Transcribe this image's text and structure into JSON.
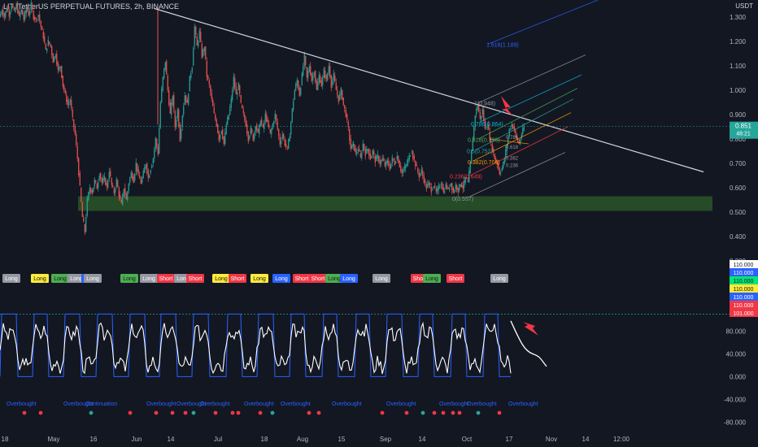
{
  "header": {
    "title": "LIT /TetherUS PERPETUAL FUTURES, 2h, BINANCE",
    "currency": "USDT"
  },
  "colors": {
    "background": "#131722",
    "up": "#26a69a",
    "down": "#ef5350",
    "trendline": "#d1d4dc",
    "demand_zone": "#2e5e2a",
    "axis_text": "#b2b5be",
    "current_price_bg": "#26a69a"
  },
  "chart_data": [
    {
      "type": "candlestick",
      "title": "LIT /TetherUS PERPETUAL FUTURES, 2h, BINANCE",
      "y_axis_ticks": [
        "1.300",
        "1.200",
        "1.100",
        "1.000",
        "0.900",
        "0.800",
        "0.700",
        "0.600",
        "0.500",
        "0.400",
        "0.300"
      ],
      "ylim": [
        0.27,
        1.37
      ],
      "x_axis_ticks": [
        "18",
        "May",
        "16",
        "Jun",
        "14",
        "Jul",
        "18",
        "Aug",
        "15",
        "Sep",
        "14",
        "Oct",
        "17",
        "Nov",
        "14",
        "12:00"
      ],
      "current_price": "0.851",
      "countdown": "48:21",
      "price_path": [
        [
          0,
          1.3
        ],
        [
          3,
          1.33
        ],
        [
          6,
          1.3
        ],
        [
          9,
          1.34
        ],
        [
          12,
          1.31
        ],
        [
          15,
          1.35
        ],
        [
          18,
          1.32
        ],
        [
          21,
          1.35
        ],
        [
          24,
          1.3
        ],
        [
          27,
          1.33
        ],
        [
          30,
          1.29
        ],
        [
          33,
          1.34
        ],
        [
          36,
          1.31
        ],
        [
          39,
          1.35
        ],
        [
          42,
          1.3
        ],
        [
          45,
          1.29
        ],
        [
          48,
          1.31
        ],
        [
          51,
          1.26
        ],
        [
          54,
          1.22
        ],
        [
          57,
          1.16
        ],
        [
          60,
          1.2
        ],
        [
          63,
          1.18
        ],
        [
          66,
          1.12
        ],
        [
          69,
          1.15
        ],
        [
          72,
          1.08
        ],
        [
          75,
          1.1
        ],
        [
          78,
          1.02
        ],
        [
          81,
          0.98
        ],
        [
          84,
          0.94
        ],
        [
          87,
          0.96
        ],
        [
          90,
          0.88
        ],
        [
          93,
          0.82
        ],
        [
          96,
          0.72
        ],
        [
          99,
          0.6
        ],
        [
          102,
          0.48
        ],
        [
          105,
          0.42
        ],
        [
          108,
          0.55
        ],
        [
          111,
          0.6
        ],
        [
          114,
          0.58
        ],
        [
          117,
          0.63
        ],
        [
          120,
          0.6
        ],
        [
          123,
          0.66
        ],
        [
          126,
          0.62
        ],
        [
          129,
          0.64
        ],
        [
          132,
          0.6
        ],
        [
          135,
          0.67
        ],
        [
          138,
          0.61
        ],
        [
          141,
          0.58
        ],
        [
          144,
          0.63
        ],
        [
          147,
          0.57
        ],
        [
          150,
          0.53
        ],
        [
          153,
          0.6
        ],
        [
          156,
          0.55
        ],
        [
          159,
          0.62
        ],
        [
          162,
          0.66
        ],
        [
          165,
          0.63
        ],
        [
          168,
          0.7
        ],
        [
          171,
          0.65
        ],
        [
          174,
          0.62
        ],
        [
          177,
          0.66
        ],
        [
          180,
          0.7
        ],
        [
          183,
          0.64
        ],
        [
          186,
          0.68
        ],
        [
          189,
          0.72
        ],
        [
          192,
          0.8
        ],
        [
          195,
          0.74
        ],
        [
          198,
          0.95
        ],
        [
          201,
          1.05
        ],
        [
          204,
          1.12
        ],
        [
          207,
          1.0
        ],
        [
          210,
          0.9
        ],
        [
          213,
          0.98
        ],
        [
          216,
          0.85
        ],
        [
          219,
          0.92
        ],
        [
          222,
          0.8
        ],
        [
          225,
          0.9
        ],
        [
          228,
          0.98
        ],
        [
          231,
          0.94
        ],
        [
          234,
          1.05
        ],
        [
          237,
          1.1
        ],
        [
          240,
          1.26
        ],
        [
          243,
          1.18
        ],
        [
          246,
          1.24
        ],
        [
          249,
          1.14
        ],
        [
          252,
          1.18
        ],
        [
          255,
          1.06
        ],
        [
          258,
          1.02
        ],
        [
          261,
          0.96
        ],
        [
          264,
          0.9
        ],
        [
          267,
          0.86
        ],
        [
          270,
          0.8
        ],
        [
          273,
          0.84
        ],
        [
          276,
          0.78
        ],
        [
          279,
          0.86
        ],
        [
          282,
          0.9
        ],
        [
          285,
          0.96
        ],
        [
          288,
          1.05
        ],
        [
          291,
          0.98
        ],
        [
          294,
          1.02
        ],
        [
          297,
          0.94
        ],
        [
          300,
          0.9
        ],
        [
          303,
          0.86
        ],
        [
          306,
          0.8
        ],
        [
          309,
          0.84
        ],
        [
          312,
          0.8
        ],
        [
          315,
          0.86
        ],
        [
          318,
          0.82
        ],
        [
          321,
          0.88
        ],
        [
          324,
          0.84
        ],
        [
          327,
          0.9
        ],
        [
          330,
          0.86
        ],
        [
          333,
          0.82
        ],
        [
          336,
          0.86
        ],
        [
          339,
          0.9
        ],
        [
          342,
          0.84
        ],
        [
          345,
          0.78
        ],
        [
          348,
          0.82
        ],
        [
          351,
          0.78
        ],
        [
          354,
          0.76
        ],
        [
          357,
          0.82
        ],
        [
          360,
          0.92
        ],
        [
          363,
          1.0
        ],
        [
          366,
          1.04
        ],
        [
          369,
          0.98
        ],
        [
          372,
          1.06
        ],
        [
          375,
          1.14
        ],
        [
          378,
          1.05
        ],
        [
          381,
          1.1
        ],
        [
          384,
          1.04
        ],
        [
          387,
          1.08
        ],
        [
          390,
          1.0
        ],
        [
          393,
          1.06
        ],
        [
          396,
          1.02
        ],
        [
          399,
          1.08
        ],
        [
          402,
          1.04
        ],
        [
          405,
          1.1
        ],
        [
          408,
          1.02
        ],
        [
          411,
          1.06
        ],
        [
          414,
          1.0
        ],
        [
          417,
          0.96
        ],
        [
          420,
          1.0
        ],
        [
          423,
          0.94
        ],
        [
          426,
          0.9
        ],
        [
          429,
          0.84
        ],
        [
          432,
          0.76
        ],
        [
          435,
          0.78
        ],
        [
          438,
          0.74
        ],
        [
          441,
          0.76
        ],
        [
          444,
          0.72
        ],
        [
          447,
          0.78
        ],
        [
          450,
          0.74
        ],
        [
          453,
          0.76
        ],
        [
          456,
          0.72
        ],
        [
          459,
          0.75
        ],
        [
          462,
          0.71
        ],
        [
          465,
          0.73
        ],
        [
          468,
          0.7
        ],
        [
          471,
          0.72
        ],
        [
          474,
          0.69
        ],
        [
          477,
          0.71
        ],
        [
          480,
          0.68
        ],
        [
          483,
          0.72
        ],
        [
          486,
          0.7
        ],
        [
          489,
          0.73
        ],
        [
          492,
          0.69
        ],
        [
          495,
          0.66
        ],
        [
          498,
          0.68
        ],
        [
          501,
          0.7
        ],
        [
          504,
          0.73
        ],
        [
          507,
          0.75
        ],
        [
          510,
          0.71
        ],
        [
          513,
          0.68
        ],
        [
          516,
          0.65
        ],
        [
          519,
          0.67
        ],
        [
          522,
          0.63
        ],
        [
          525,
          0.6
        ],
        [
          528,
          0.62
        ],
        [
          531,
          0.59
        ],
        [
          534,
          0.61
        ],
        [
          537,
          0.58
        ],
        [
          540,
          0.6
        ],
        [
          543,
          0.62
        ],
        [
          546,
          0.58
        ],
        [
          549,
          0.61
        ],
        [
          552,
          0.59
        ],
        [
          555,
          0.62
        ],
        [
          558,
          0.58
        ],
        [
          561,
          0.61
        ],
        [
          564,
          0.59
        ],
        [
          567,
          0.62
        ],
        [
          570,
          0.6
        ],
        [
          573,
          0.64
        ],
        [
          576,
          0.62
        ],
        [
          579,
          0.7
        ],
        [
          582,
          0.8
        ],
        [
          585,
          0.9
        ],
        [
          588,
          0.94
        ],
        [
          591,
          0.88
        ],
        [
          594,
          0.92
        ],
        [
          597,
          0.84
        ],
        [
          600,
          0.86
        ],
        [
          603,
          0.8
        ],
        [
          606,
          0.76
        ],
        [
          609,
          0.72
        ],
        [
          612,
          0.7
        ],
        [
          615,
          0.66
        ],
        [
          618,
          0.68
        ],
        [
          621,
          0.72
        ],
        [
          624,
          0.78
        ],
        [
          627,
          0.84
        ],
        [
          630,
          0.86
        ],
        [
          633,
          0.84
        ],
        [
          636,
          0.8
        ],
        [
          639,
          0.78
        ],
        [
          642,
          0.82
        ],
        [
          645,
          0.85
        ]
      ],
      "trendline": {
        "from": [
          190,
          1.335
        ],
        "to": [
          865,
          0.665
        ]
      },
      "demand_zone": {
        "x_from": 96,
        "x_to": 876,
        "y_from": 0.505,
        "y_to": 0.565
      },
      "fib_labels": [
        {
          "text": "1.618(1.189)",
          "value": 1.189,
          "x": 598,
          "color": "#2962ff"
        },
        {
          "text": "1(0.948)",
          "value": 0.948,
          "x": 583,
          "color": "#9598a1"
        },
        {
          "text": "0.786(0.864)",
          "value": 0.864,
          "x": 579,
          "color": "#00bcd4"
        },
        {
          "text": "0.618(0.798)",
          "value": 0.798,
          "x": 575,
          "color": "#4caf50"
        },
        {
          "text": "0.5(0.752)",
          "value": 0.752,
          "x": 574,
          "color": "#26a69a"
        },
        {
          "text": "0.382(0.706)",
          "value": 0.706,
          "x": 575,
          "color": "#ff9800"
        },
        {
          "text": "0.236(0.649)",
          "value": 0.649,
          "x": 553,
          "color": "#f23645"
        },
        {
          "text": "0(0.557)",
          "value": 0.557,
          "x": 556,
          "color": "#9598a1"
        }
      ],
      "small_fib_labels": [
        {
          "text": "0.786",
          "value": 0.81
        },
        {
          "text": "0.618",
          "value": 0.77
        },
        {
          "text": "0.382",
          "value": 0.725
        },
        {
          "text": "0.236",
          "value": 0.695
        }
      ]
    },
    {
      "type": "line",
      "y_axis_ticks": [
        "80.000",
        "40.000",
        "0.000",
        "-40.000",
        "-80.000"
      ],
      "ylim": [
        -88,
        112
      ],
      "right_badges": [
        {
          "text": "110.000",
          "color": "#ffffff",
          "fg": "#131722"
        },
        {
          "text": "110.000",
          "color": "#2962ff",
          "fg": "#ffffff"
        },
        {
          "text": "110.000",
          "color": "#00e676",
          "fg": "#131722"
        },
        {
          "text": "110.000",
          "color": "#ffeb3b",
          "fg": "#131722"
        },
        {
          "text": "110.000",
          "color": "#2962ff",
          "fg": "#ffffff"
        },
        {
          "text": "110.000",
          "color": "#f23645",
          "fg": "#ffffff"
        },
        {
          "text": "101.000",
          "color": "#f23645",
          "fg": "#ffffff"
        }
      ],
      "signal_labels": [
        {
          "text": "Long",
          "x": 3,
          "color": "#9598a1"
        },
        {
          "text": "Long",
          "x": 38,
          "color": "#ffeb3b"
        },
        {
          "text": "Long",
          "x": 63,
          "color": "#4caf50"
        },
        {
          "text": "Long",
          "x": 83,
          "color": "#9598a1"
        },
        {
          "text": "Long",
          "x": 100,
          "color": "#2962ff"
        },
        {
          "text": "Long",
          "x": 103,
          "color": "#9598a1"
        },
        {
          "text": "Long",
          "x": 148,
          "color": "#4caf50"
        },
        {
          "text": "Long",
          "x": 172,
          "color": "#9598a1"
        },
        {
          "text": "Short",
          "x": 193,
          "color": "#f23645"
        },
        {
          "text": "Long",
          "x": 214,
          "color": "#9598a1"
        },
        {
          "text": "Short",
          "x": 229,
          "color": "#f23645"
        },
        {
          "text": "Long",
          "x": 261,
          "color": "#ffeb3b"
        },
        {
          "text": "Short",
          "x": 281,
          "color": "#f23645"
        },
        {
          "text": "Long",
          "x": 308,
          "color": "#ffeb3b"
        },
        {
          "text": "Long",
          "x": 335,
          "color": "#2962ff"
        },
        {
          "text": "Short",
          "x": 360,
          "color": "#f23645"
        },
        {
          "text": "Short",
          "x": 380,
          "color": "#f23645"
        },
        {
          "text": "Long",
          "x": 400,
          "color": "#4caf50"
        },
        {
          "text": "Long",
          "x": 418,
          "color": "#2962ff"
        },
        {
          "text": "Long",
          "x": 458,
          "color": "#9598a1"
        },
        {
          "text": "Short",
          "x": 505,
          "color": "#f23645"
        },
        {
          "text": "Long",
          "x": 520,
          "color": "#4caf50"
        },
        {
          "text": "Short",
          "x": 549,
          "color": "#f23645"
        },
        {
          "text": "Long",
          "x": 603,
          "color": "#9598a1"
        }
      ],
      "overbought_labels": [
        {
          "text": "Overbought",
          "x": 8
        },
        {
          "text": "Overbought",
          "x": 78
        },
        {
          "text": "Continuation",
          "x": 105
        },
        {
          "text": "Overbought",
          "x": 180
        },
        {
          "text": "Overbought",
          "x": 217
        },
        {
          "text": "Overbought",
          "x": 246
        },
        {
          "text": "Overbought",
          "x": 300
        },
        {
          "text": "Overbought",
          "x": 345
        },
        {
          "text": "Overbought",
          "x": 408
        },
        {
          "text": "Overbought",
          "x": 475
        },
        {
          "text": "Overbought",
          "x": 540
        },
        {
          "text": "Overbought",
          "x": 574
        },
        {
          "text": "Overbought",
          "x": 625
        }
      ]
    }
  ]
}
